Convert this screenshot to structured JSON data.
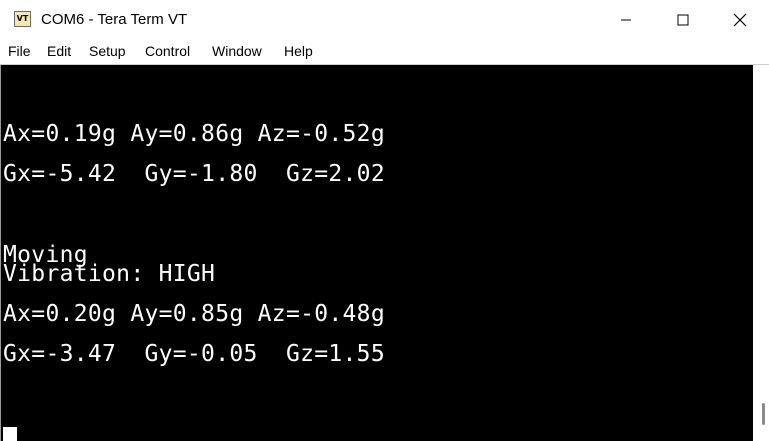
{
  "window": {
    "title": "COM6 - Tera Term VT",
    "icon_text": "VT",
    "controls": [
      "minimize-icon",
      "maximize-icon",
      "close-icon"
    ]
  },
  "menu": [
    "File",
    "Edit",
    "Setup",
    "Control",
    "Window",
    "Help"
  ],
  "terminal": {
    "lines": [
      "Ax=0.19g Ay=0.86g Az=-0.52g",
      "Gx=-5.42  Gy=-1.80  Gz=2.02",
      "Moving",
      "Vibration: HIGH",
      "Ax=0.20g Ay=0.85g Az=-0.48g",
      "Gx=-3.47  Gy=-0.05  Gz=1.55"
    ],
    "background": "#000000",
    "foreground": "#ffffff"
  }
}
